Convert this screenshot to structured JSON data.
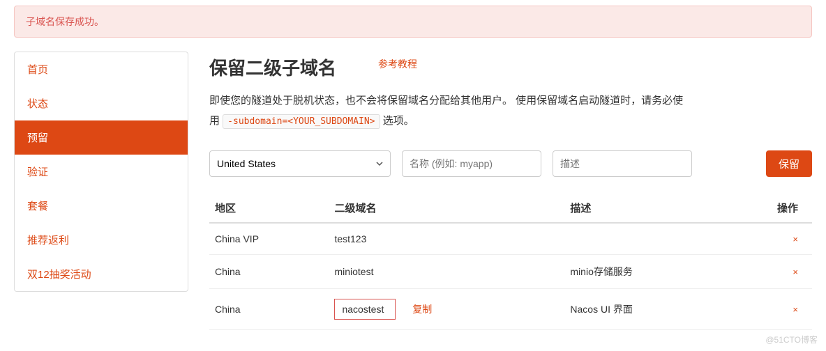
{
  "alert": {
    "message": "子域名保存成功。"
  },
  "sidebar": {
    "items": [
      {
        "label": "首页",
        "active": false
      },
      {
        "label": "状态",
        "active": false
      },
      {
        "label": "预留",
        "active": true
      },
      {
        "label": "验证",
        "active": false
      },
      {
        "label": "套餐",
        "active": false
      },
      {
        "label": "推荐返利",
        "active": false
      },
      {
        "label": "双12抽奖活动",
        "active": false
      }
    ]
  },
  "main": {
    "title": "保留二级子域名",
    "tutorial_link": "参考教程",
    "desc_part1": "即使您的隧道处于脱机状态，也不会将保留域名分配给其他用户。 使用保留域名启动隧道时，请务必使用 ",
    "desc_code": "-subdomain=<YOUR_SUBDOMAIN>",
    "desc_part2": " 选项。"
  },
  "form": {
    "region_selected": "United States",
    "name_placeholder": "名称 (例如: myapp)",
    "desc_placeholder": "描述",
    "reserve_btn": "保留"
  },
  "table": {
    "headers": {
      "region": "地区",
      "subdomain": "二级域名",
      "description": "描述",
      "action": "操作"
    },
    "copy_label": "复制",
    "rows": [
      {
        "region": "China VIP",
        "subdomain": "test123",
        "description": "",
        "highlight": false
      },
      {
        "region": "China",
        "subdomain": "miniotest",
        "description": "minio存储服务",
        "highlight": false
      },
      {
        "region": "China",
        "subdomain": "nacostest",
        "description": "Nacos UI 界面",
        "highlight": true
      }
    ]
  },
  "watermark": "@51CTO博客"
}
